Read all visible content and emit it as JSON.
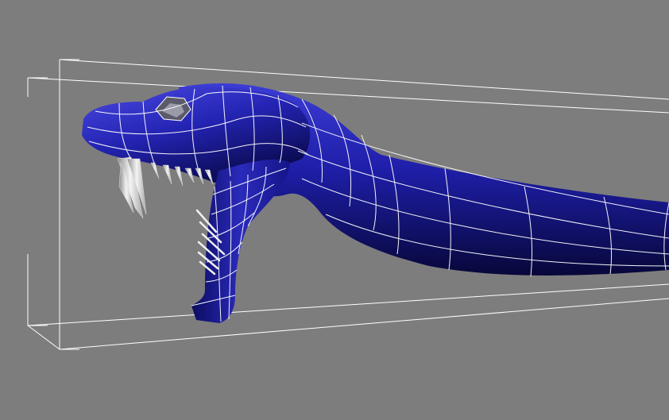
{
  "viewport": {
    "background": "#7d7d7d",
    "wire_color": "#ffffff",
    "mesh_color": "#1e1ea8",
    "tooth_color": "#e8e8e8"
  }
}
